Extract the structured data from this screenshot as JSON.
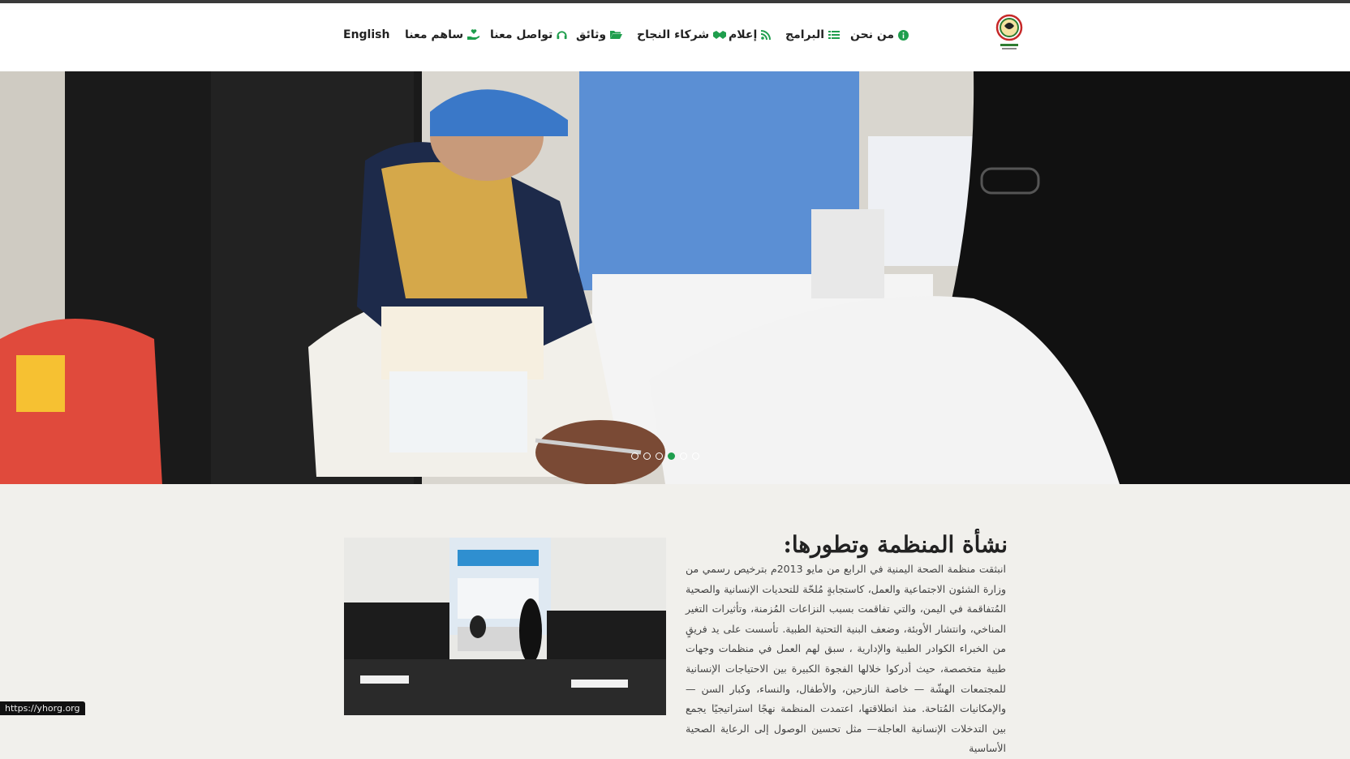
{
  "nav": {
    "items": [
      {
        "label": "من نحن",
        "icon": "info-circle-icon"
      },
      {
        "label": "البرامج",
        "icon": "list-icon"
      },
      {
        "label": "إعلام",
        "icon": "rss-icon"
      },
      {
        "label": "شركاء النجاح",
        "icon": "handshake-icon"
      },
      {
        "label": "وثائق",
        "icon": "folder-open-icon"
      },
      {
        "label": "تواصل معنا",
        "icon": "headset-icon"
      },
      {
        "label": "ساهم معنا",
        "icon": "hand-holding-heart-icon"
      },
      {
        "label": "English",
        "icon": ""
      }
    ],
    "logo": "organization-logo"
  },
  "slider": {
    "slide_count": 6,
    "active_index": 3,
    "accent": "#1f9e4d"
  },
  "about": {
    "title": "نشأة المنظمة وتطورها:",
    "text": "انبثقت منظمة الصحة اليمنية في الرابع من مايو 2013م بترخيص رسمي من وزارة الشئون الاجتماعية والعمل، كاستجابةٍ مُلحّة للتحديات الإنسانية والصحية المُتفاقمة في اليمن، والتي تفاقمت بسبب النزاعات المُزمنة، وتأثيرات التغير المناخي، وانتشار الأوبئة، وضعف البنية التحتية الطبية. تأسست على يد فريقٍ من الخبراء الكوادر الطبية والإدارية ، سبق لهم العمل في منظمات وجهات طبية متخصصة، حيث أدركوا خلالها الفجوة الكبيرة بين الاحتياجات الإنسانية للمجتمعات الهشّة — خاصة النازحين، والأطفال، والنساء، وكبار السن — والإمكانيات المُتاحة. منذ انطلاقتها، اعتمدت المنظمة نهجًا استراتيجيًا يجمع بين التدخلات الإنسانية العاجلة— مثل تحسين الوصول إلى الرعاية الصحية الأساسية"
  },
  "status_bar": {
    "url": "https://yhorg.org"
  }
}
